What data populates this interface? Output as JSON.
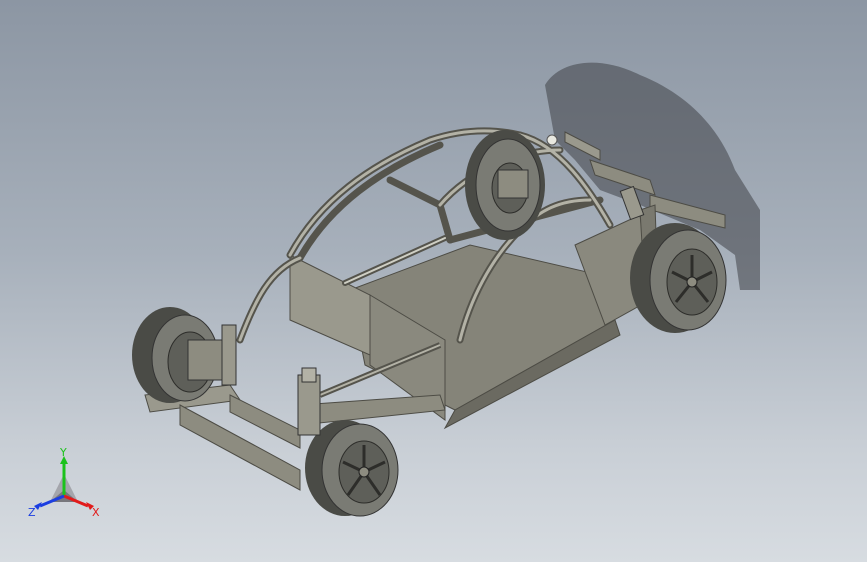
{
  "viewport": {
    "model": "vehicle-chassis-assembly",
    "display_mode": "shaded-with-edges",
    "shadows": true
  },
  "triad": {
    "x_label": "X",
    "y_label": "Y",
    "z_label": "Z",
    "x_color": "#e11b1b",
    "y_color": "#1bc21b",
    "z_color": "#1b3ee1"
  },
  "colors": {
    "frame": "#8d8c80",
    "frame_dark": "#5f5e55",
    "frame_light": "#b3b2a6",
    "tire": "#7a7b74",
    "tire_dark": "#4a4b46",
    "shadow": "#3f4247"
  }
}
